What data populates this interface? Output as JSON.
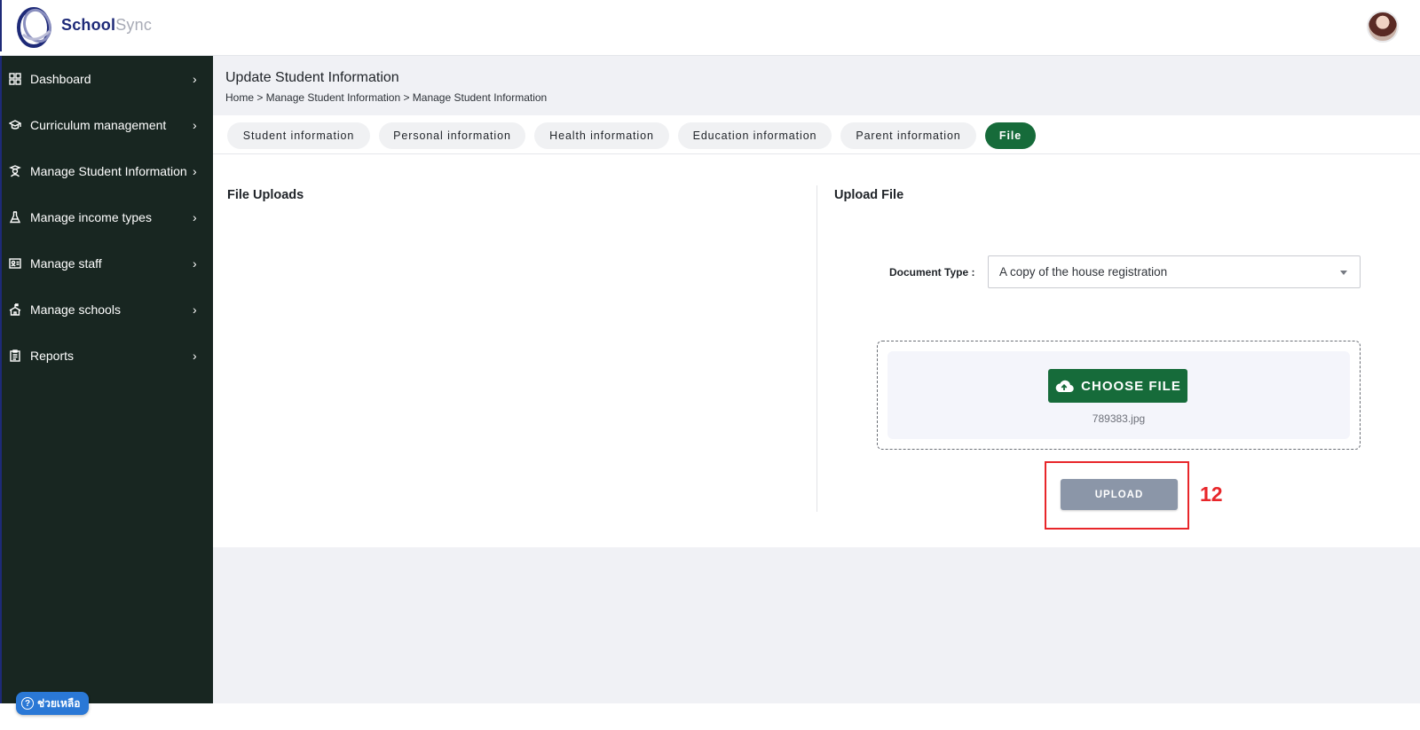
{
  "app": {
    "brand_primary": "School",
    "brand_secondary": "Sync"
  },
  "colors": {
    "sidebar_bg": "#182621",
    "accent_green": "#166b3a",
    "annotation_red": "#e8262a",
    "upload_disabled": "#8b96a8",
    "help_blue": "#2a78d6"
  },
  "sidebar": {
    "items": [
      {
        "label": "Dashboard",
        "icon": "grid-icon"
      },
      {
        "label": "Curriculum management",
        "icon": "graduation-cap-icon"
      },
      {
        "label": "Manage Student Information",
        "icon": "student-icon"
      },
      {
        "label": "Manage income types",
        "icon": "flask-icon"
      },
      {
        "label": "Manage staff",
        "icon": "id-card-icon"
      },
      {
        "label": "Manage schools",
        "icon": "school-icon"
      },
      {
        "label": "Reports",
        "icon": "clipboard-icon"
      }
    ]
  },
  "help": {
    "label": "ช่วยเหลือ"
  },
  "header": {
    "title": "Update Student Information",
    "breadcrumb": "Home > Manage Student Information > Manage Student Information"
  },
  "tabs": [
    {
      "label": "Student information",
      "active": false
    },
    {
      "label": "Personal information",
      "active": false
    },
    {
      "label": "Health information",
      "active": false
    },
    {
      "label": "Education information",
      "active": false
    },
    {
      "label": "Parent information",
      "active": false
    },
    {
      "label": "File",
      "active": true
    }
  ],
  "file_uploads": {
    "heading": "File Uploads"
  },
  "upload_file": {
    "heading": "Upload File",
    "document_type_label": "Document Type :",
    "document_type_value": "A copy of the house registration",
    "choose_file_label": "CHOOSE FILE",
    "selected_file": "789383.jpg",
    "upload_label": "UPLOAD"
  },
  "annotation": {
    "step_number": "12"
  }
}
